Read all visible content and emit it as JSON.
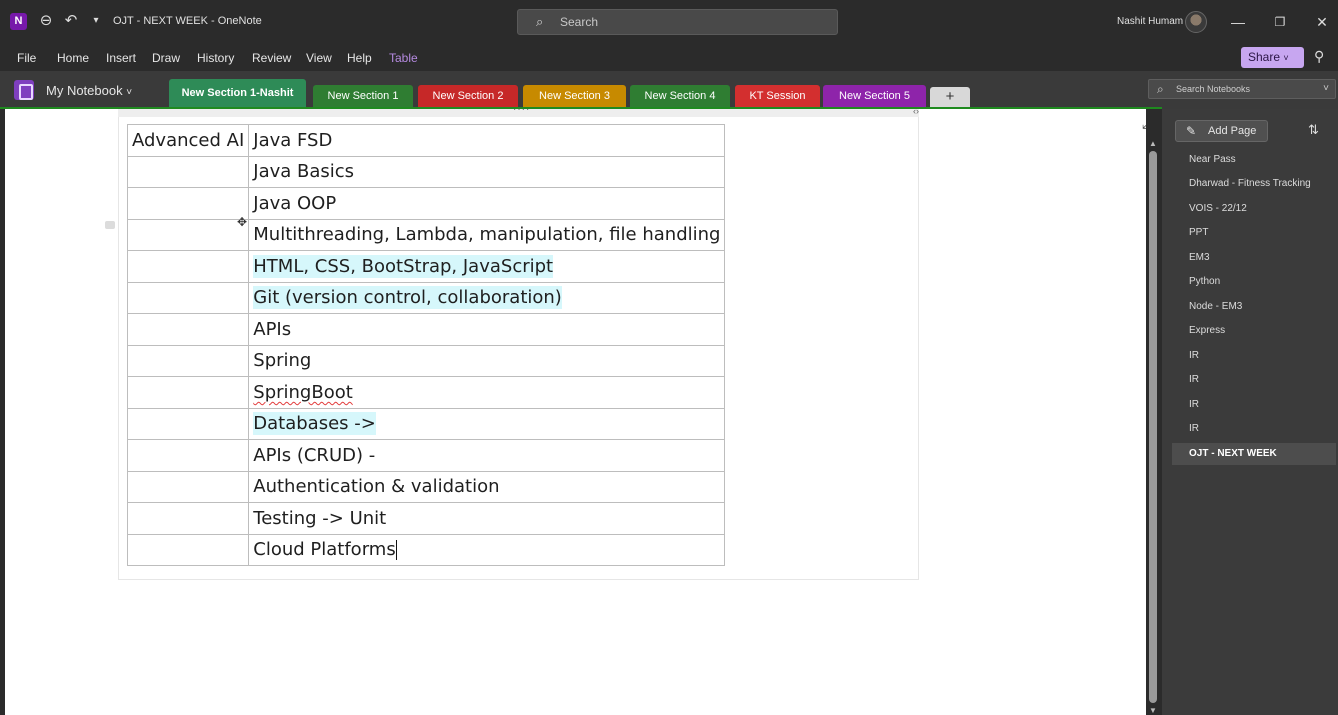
{
  "titlebar": {
    "app_icon": "N",
    "doc_title": "OJT - NEXT WEEK  -  OneNote",
    "search_placeholder": "Search",
    "user_name": "Nashit Humam",
    "icons": [
      "back-icon",
      "undo-icon",
      "customize-icon",
      "search-icon",
      "minimize-icon",
      "restore-icon",
      "close-icon"
    ]
  },
  "menu": {
    "items": [
      "File",
      "Home",
      "Insert",
      "Draw",
      "History",
      "Review",
      "View",
      "Help",
      "Table"
    ],
    "accent_color": "#b58ae0",
    "share_label": "Share",
    "share_color": "#c7a6f0"
  },
  "notebook": {
    "name": "My Notebook",
    "search_placeholder": "Search Notebooks"
  },
  "sections": [
    {
      "label": "New Section 1-Nashit",
      "color": "#2e8b57",
      "active": true
    },
    {
      "label": "New Section 1",
      "color": "#2f7d32"
    },
    {
      "label": "New Section 2",
      "color": "#c62828"
    },
    {
      "label": "New Section 3",
      "color": "#c78a00"
    },
    {
      "label": "New Section 4",
      "color": "#2f7d32"
    },
    {
      "label": "KT Session",
      "color": "#d32f2f"
    },
    {
      "label": "New Section 5",
      "color": "#8e24aa"
    }
  ],
  "add_section_label": "+",
  "table": {
    "rows": [
      [
        "Advanced AI",
        "Java FSD"
      ],
      [
        "",
        "Java Basics"
      ],
      [
        "",
        "Java OOP"
      ],
      [
        "",
        "Multithreading, Lambda, manipulation, file handling"
      ],
      [
        "",
        "HTML, CSS, BootStrap, JavaScript"
      ],
      [
        "",
        "Git (version control, collaboration)"
      ],
      [
        "",
        "APIs"
      ],
      [
        "",
        "Spring"
      ],
      [
        "",
        "SpringBoot"
      ],
      [
        "",
        "Databases ->"
      ],
      [
        "",
        "APIs (CRUD) -"
      ],
      [
        "",
        "Authentication & validation"
      ],
      [
        "",
        "Testing -> Unit"
      ],
      [
        "",
        "Cloud Platforms"
      ]
    ],
    "highlight_color": "#d6f7fb"
  },
  "pages": {
    "add_label": "Add Page",
    "items": [
      "Near Pass",
      "Dharwad - Fitness Tracking",
      "VOIS - 22/12",
      "PPT",
      "EM3",
      "Python",
      "Node - EM3",
      "Express",
      "IR",
      "IR",
      "IR",
      "IR",
      "OJT - NEXT WEEK"
    ],
    "active": "OJT - NEXT WEEK"
  }
}
